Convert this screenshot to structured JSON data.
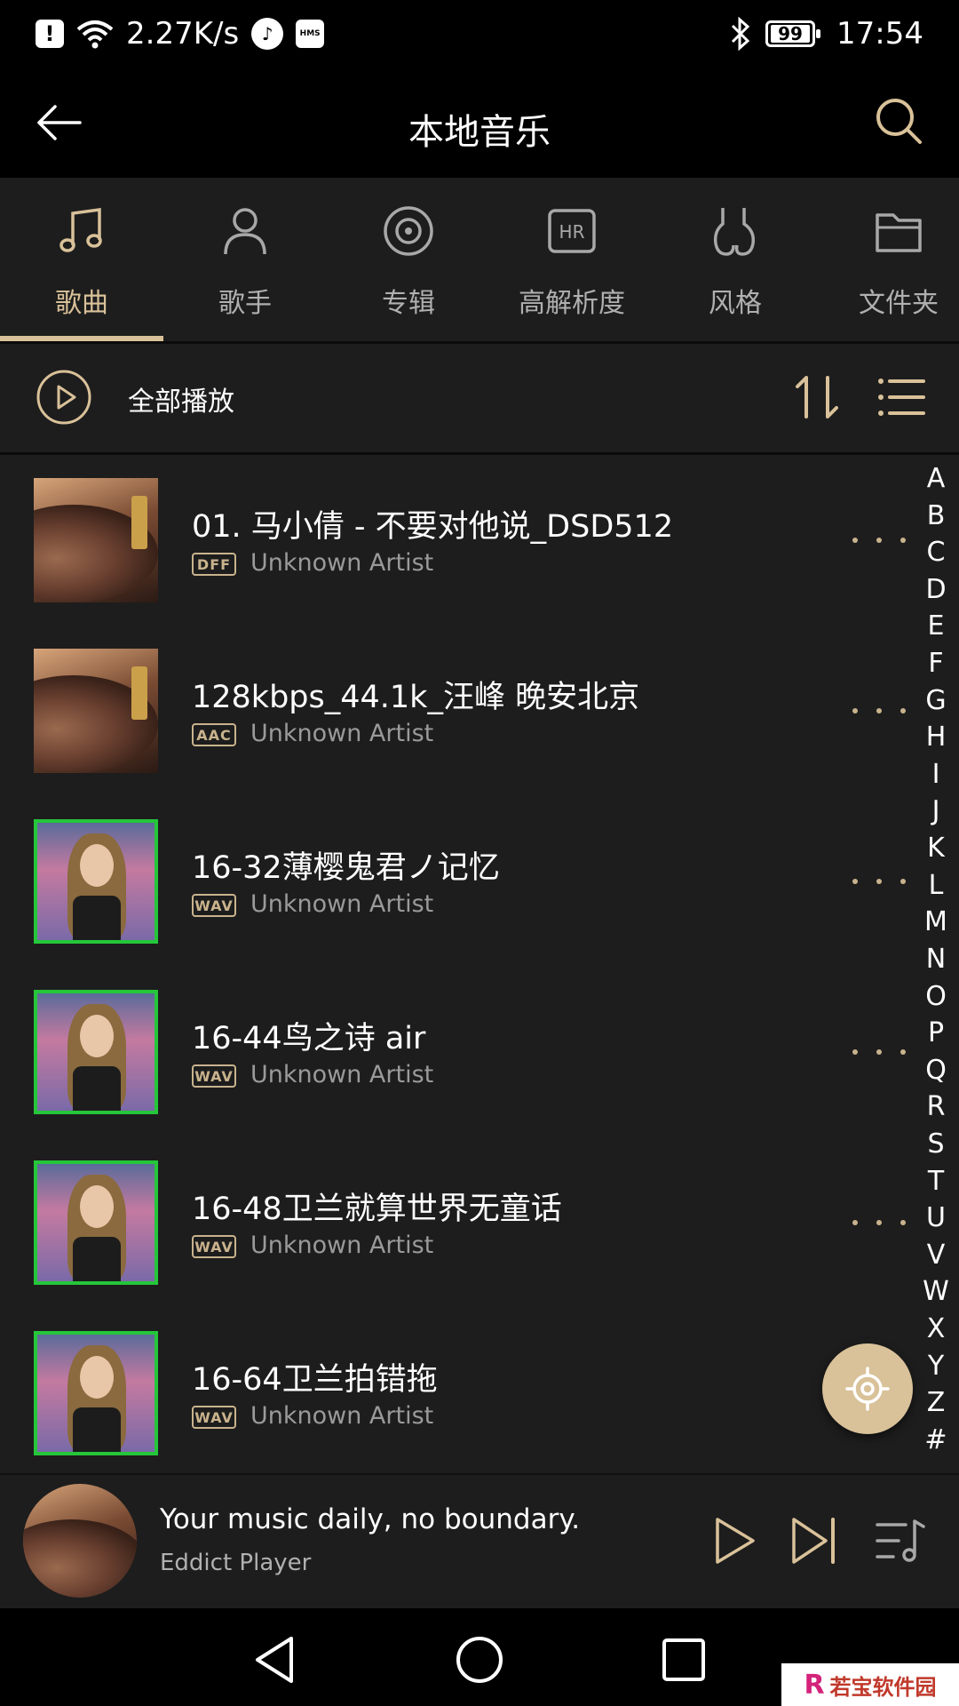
{
  "status_bar": {
    "speed": "2.27K/s",
    "hms": "HMS",
    "battery": "99",
    "time": "17:54"
  },
  "header": {
    "title": "本地音乐"
  },
  "tabs": [
    {
      "label": "歌曲",
      "icon": "music-note-icon",
      "active": true
    },
    {
      "label": "歌手",
      "icon": "person-icon",
      "active": false
    },
    {
      "label": "专辑",
      "icon": "disc-icon",
      "active": false
    },
    {
      "label": "高解析度",
      "icon": "hr-icon",
      "active": false
    },
    {
      "label": "风格",
      "icon": "guitar-icon",
      "active": false
    },
    {
      "label": "文件夹",
      "icon": "folder-icon",
      "active": false
    }
  ],
  "toolbar": {
    "play_all": "全部播放"
  },
  "songs": [
    {
      "title": "01. 马小倩 - 不要对他说_DSD512",
      "format": "DFF",
      "artist": "Unknown Artist",
      "cover": "vinyl"
    },
    {
      "title": "128kbps_44.1k_汪峰 晚安北京",
      "format": "AAC",
      "artist": "Unknown Artist",
      "cover": "vinyl"
    },
    {
      "title": "16-32薄樱鬼君ノ记忆",
      "format": "WAV",
      "artist": "Unknown Artist",
      "cover": "photo"
    },
    {
      "title": "16-44鸟之诗 air",
      "format": "WAV",
      "artist": "Unknown Artist",
      "cover": "photo"
    },
    {
      "title": "16-48卫兰就算世界无童话",
      "format": "WAV",
      "artist": "Unknown Artist",
      "cover": "photo"
    },
    {
      "title": "16-64卫兰拍错拖",
      "format": "WAV",
      "artist": "Unknown Artist",
      "cover": "photo"
    }
  ],
  "alphabet": [
    "A",
    "B",
    "C",
    "D",
    "E",
    "F",
    "G",
    "H",
    "I",
    "J",
    "K",
    "L",
    "M",
    "N",
    "O",
    "P",
    "Q",
    "R",
    "S",
    "T",
    "U",
    "V",
    "W",
    "X",
    "Y",
    "Z",
    "#"
  ],
  "mini_player": {
    "title": "Your music daily, no boundary.",
    "subtitle": "Eddict Player"
  },
  "watermark": {
    "logo": "R",
    "text": "若宝软件园"
  },
  "colors": {
    "accent": "#d9c199",
    "background": "#1d1d1d",
    "cover_border": "#25c63a"
  }
}
